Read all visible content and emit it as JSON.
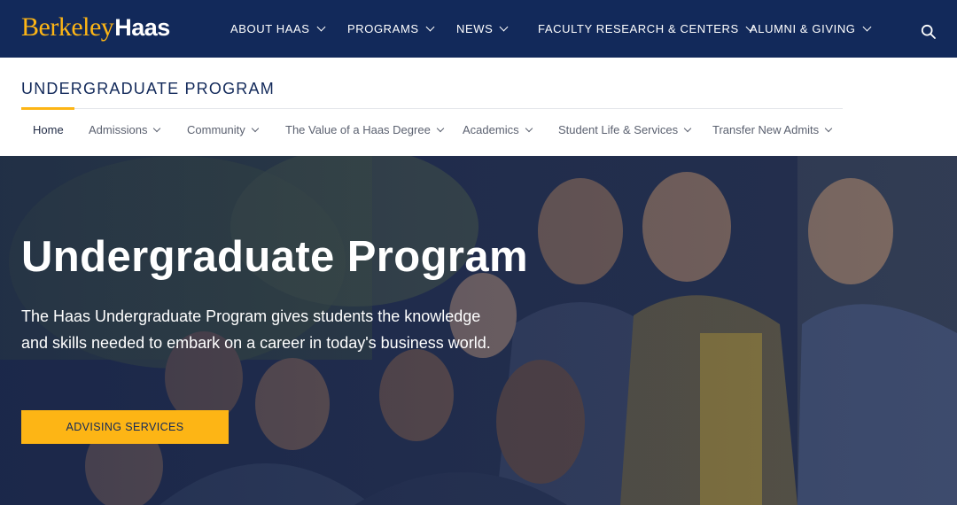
{
  "brand": {
    "logo_part1": "Berkeley",
    "logo_part2": "Haas",
    "primary_color": "#12295a",
    "accent_color": "#fdb515"
  },
  "topnav": {
    "items": [
      {
        "label": "ABOUT HAAS"
      },
      {
        "label": "PROGRAMS"
      },
      {
        "label": "NEWS"
      },
      {
        "label": "FACULTY RESEARCH & CENTERS"
      },
      {
        "label": "ALUMNI & GIVING"
      }
    ],
    "search_icon": "search-icon"
  },
  "subheader": {
    "title": "UNDERGRADUATE PROGRAM",
    "nav": [
      {
        "label": "Home"
      },
      {
        "label": "Admissions"
      },
      {
        "label": "Community"
      },
      {
        "label": "The Value of a Haas Degree"
      },
      {
        "label": "Academics"
      },
      {
        "label": "Student Life & Services"
      },
      {
        "label": "Transfer New Admits"
      }
    ]
  },
  "hero": {
    "title": "Undergraduate Program",
    "description": "The Haas Undergraduate Program gives students the knowledge and skills needed to embark on a career in today's business world.",
    "cta_label": "ADVISING SERVICES"
  }
}
